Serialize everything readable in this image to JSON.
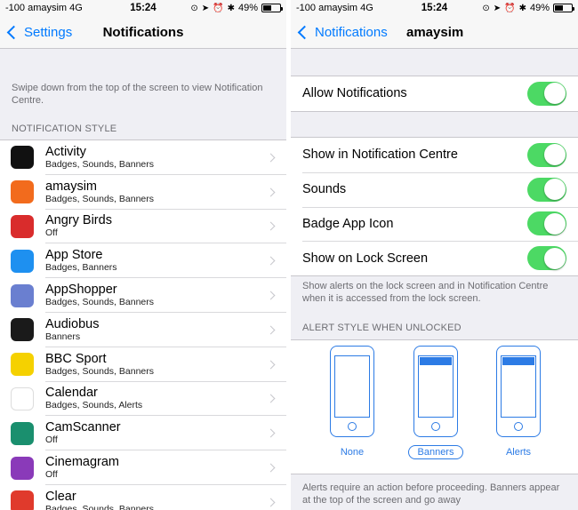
{
  "status_bar": {
    "carrier": "-100 amaysim",
    "network": "4G",
    "time": "15:24",
    "battery": "49%",
    "battery_level": 0.49
  },
  "left": {
    "nav": {
      "back_label": "Settings",
      "title": "Notifications"
    },
    "note": "Swipe down from the top of the screen to view Notification Centre.",
    "section_header": "NOTIFICATION STYLE",
    "apps": [
      {
        "name": "Activity",
        "sub": "Badges, Sounds, Banners",
        "icon": "activity-icon",
        "color": "#111111"
      },
      {
        "name": "amaysim",
        "sub": "Badges, Sounds, Banners",
        "icon": "amaysim-icon",
        "color": "#f26b1d"
      },
      {
        "name": "Angry Birds",
        "sub": "Off",
        "icon": "angry-birds-icon",
        "color": "#d92c2c"
      },
      {
        "name": "App Store",
        "sub": "Badges, Banners",
        "icon": "app-store-icon",
        "color": "#1e90f0"
      },
      {
        "name": "AppShopper",
        "sub": "Badges, Sounds, Banners",
        "icon": "appshopper-icon",
        "color": "#6a7fd0"
      },
      {
        "name": "Audiobus",
        "sub": "Banners",
        "icon": "audiobus-icon",
        "color": "#1a1a1a"
      },
      {
        "name": "BBC Sport",
        "sub": "Badges, Sounds, Banners",
        "icon": "bbc-sport-icon",
        "color": "#f5d100"
      },
      {
        "name": "Calendar",
        "sub": "Badges, Sounds, Alerts",
        "icon": "calendar-icon",
        "color": "#ffffff"
      },
      {
        "name": "CamScanner",
        "sub": "Off",
        "icon": "camscanner-icon",
        "color": "#1a8f6e"
      },
      {
        "name": "Cinemagram",
        "sub": "Off",
        "icon": "cinemagram-icon",
        "color": "#8a3ab9"
      },
      {
        "name": "Clear",
        "sub": "Badges, Sounds, Banners",
        "icon": "clear-icon",
        "color": "#e03a2c"
      }
    ]
  },
  "right": {
    "nav": {
      "back_label": "Notifications",
      "title": "amaysim"
    },
    "allow_notifications": {
      "label": "Allow Notifications",
      "on": true
    },
    "toggles": [
      {
        "label": "Show in Notification Centre",
        "on": true
      },
      {
        "label": "Sounds",
        "on": true
      },
      {
        "label": "Badge App Icon",
        "on": true
      },
      {
        "label": "Show on Lock Screen",
        "on": true
      }
    ],
    "lock_screen_note": "Show alerts on the lock screen and in Notification Centre when it is accessed from the lock screen.",
    "alert_style_header": "ALERT STYLE WHEN UNLOCKED",
    "alert_styles": [
      {
        "label": "None",
        "selected": false
      },
      {
        "label": "Banners",
        "selected": true
      },
      {
        "label": "Alerts",
        "selected": false
      }
    ],
    "alert_note": "Alerts require an action before proceeding. Banners appear at the top of the screen and go away"
  },
  "colors": {
    "accent": "#007aff",
    "switch_on": "#4cd964",
    "background": "#efeff4"
  }
}
